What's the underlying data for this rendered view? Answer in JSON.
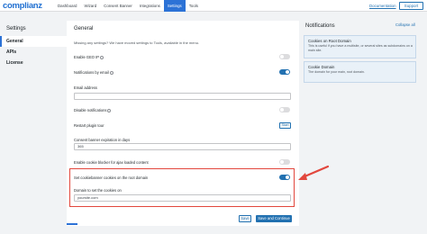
{
  "header": {
    "logo": "complianz",
    "nav": [
      "Dashboard",
      "Wizard",
      "Consent Banner",
      "Integrations",
      "Settings",
      "Tools"
    ],
    "active_nav": "Settings",
    "documentation": "Documentation",
    "support": "Support"
  },
  "sidebar": {
    "title": "Settings",
    "items": [
      "General",
      "APIs",
      "License"
    ],
    "active": "General"
  },
  "main": {
    "title": "General",
    "missing_text": "Missing any settings? We have moved settings to Tools, available in the menu.",
    "enable_geo_ip": {
      "label": "Enable GEO IP",
      "on": false
    },
    "notifications_email": {
      "label": "Notifications by email",
      "on": true
    },
    "email_address": {
      "label": "Email address",
      "value": ""
    },
    "disable_notifications": {
      "label": "Disable notifications",
      "on": false
    },
    "restart_tour": {
      "label": "Restart plugin tour",
      "button": "Start"
    },
    "consent_expiration": {
      "label": "Consent banner expiration in days",
      "value": "365"
    },
    "enable_cookie_blocker": {
      "label": "Enable cookie blocker for ajax loaded content",
      "on": false
    },
    "root_domain_toggle": {
      "label": "Set cookiebanner cookies on the root domain",
      "on": true
    },
    "domain_field": {
      "label": "Domain to set the cookies on",
      "value": "yoursite.com"
    },
    "save": "Save",
    "save_continue": "Save and Continue"
  },
  "notifications": {
    "title": "Notifications",
    "collapse_all": "Collapse all",
    "cards": [
      {
        "title": "Cookies on Root Domain",
        "body": "This is useful if you have a multisite, or several sites as subdomains on a main site."
      },
      {
        "title": "Cookie Domain",
        "body": "The domain for your main, root domain."
      }
    ]
  },
  "colors": {
    "accent": "#2271b1",
    "highlight": "#e2473d"
  }
}
